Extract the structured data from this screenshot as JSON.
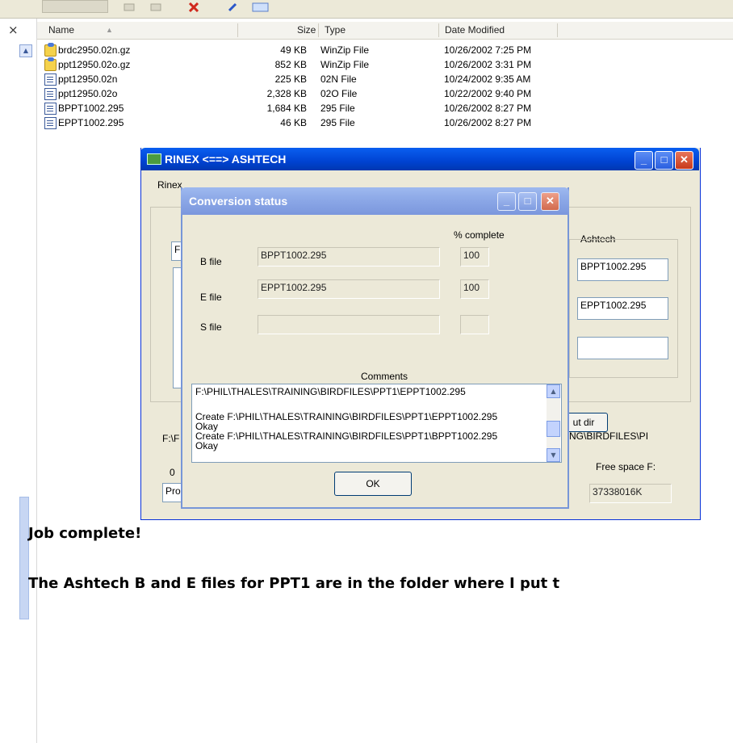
{
  "explorer": {
    "columns": {
      "name": "Name",
      "size": "Size",
      "type": "Type",
      "date": "Date Modified"
    },
    "files": [
      {
        "name": "brdc2950.02n.gz",
        "size": "49 KB",
        "type": "WinZip File",
        "date": "10/26/2002 7:25 PM",
        "icon": "zip-icon"
      },
      {
        "name": "ppt12950.02o.gz",
        "size": "852 KB",
        "type": "WinZip File",
        "date": "10/26/2002 3:31 PM",
        "icon": "zip-icon"
      },
      {
        "name": "ppt12950.02n",
        "size": "225 KB",
        "type": "02N File",
        "date": "10/24/2002 9:35 AM",
        "icon": "file-icon"
      },
      {
        "name": "ppt12950.02o",
        "size": "2,328 KB",
        "type": "02O File",
        "date": "10/22/2002 9:40 PM",
        "icon": "file-icon"
      },
      {
        "name": "BPPT1002.295",
        "size": "1,684 KB",
        "type": "295 File",
        "date": "10/26/2002 8:27 PM",
        "icon": "file-icon"
      },
      {
        "name": "EPPT1002.295",
        "size": "46 KB",
        "type": "295 File",
        "date": "10/26/2002 8:27 PM",
        "icon": "file-icon"
      }
    ],
    "close_glyph": "×"
  },
  "rinex": {
    "title": "RINEX <==> ASHTECH",
    "tab_label": "Rinex",
    "ashtech_label": "Ashtech",
    "b_field": "BPPT1002.295",
    "e_field": "EPPT1002.295",
    "s_field": "",
    "left_field_fragment": "F",
    "path_fragment_left": "F:\\F",
    "output_dir_button": "ut dir",
    "path_fragment_right": "NING\\BIRDFILES\\PI",
    "label_fragment": "0",
    "pro_fragment": "Pro",
    "free_space_label": "Free space F:",
    "free_space_value": "37338016K"
  },
  "conversion": {
    "title": "Conversion status",
    "percent_header": "% complete",
    "rows": [
      {
        "label": "B file",
        "file": "BPPT1002.295",
        "percent": "100"
      },
      {
        "label": "E file",
        "file": "EPPT1002.295",
        "percent": "100"
      },
      {
        "label": "S file",
        "file": "",
        "percent": ""
      }
    ],
    "comments_label": "Comments",
    "comments": [
      "F:\\PHIL\\THALES\\TRAINING\\BIRDFILES\\PPT1\\EPPT1002.295",
      "",
      "Create  F:\\PHIL\\THALES\\TRAINING\\BIRDFILES\\PPT1\\EPPT1002.295",
      "Okay",
      "Create  F:\\PHIL\\THALES\\TRAINING\\BIRDFILES\\PPT1\\BPPT1002.295",
      "Okay"
    ],
    "ok_label": "OK"
  },
  "caption": {
    "line1": "Job complete!",
    "line2": "The Ashtech B and E files for PPT1 are in the folder where I put t"
  }
}
